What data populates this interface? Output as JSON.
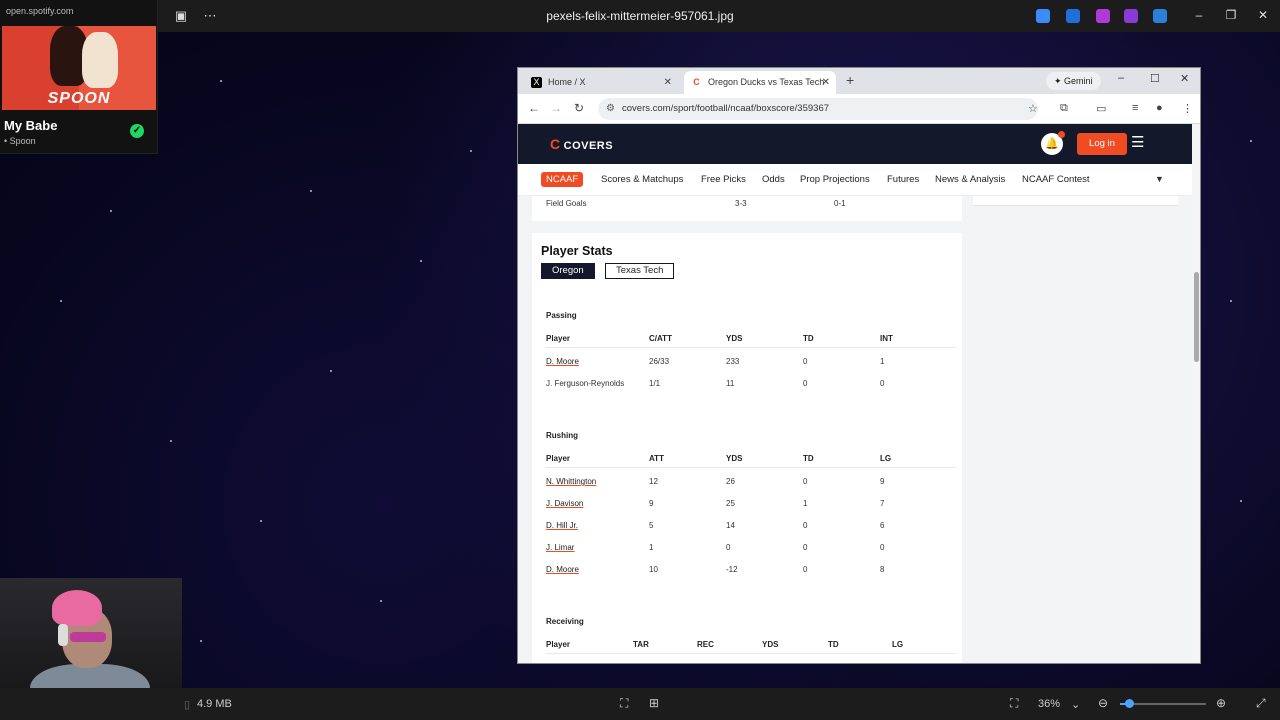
{
  "viewer": {
    "title": "pexels-felix-mittermeier-957061.jpg",
    "file_size": "4.9 MB",
    "zoom": "36%"
  },
  "spotify": {
    "url": "open.spotify.com",
    "album_text": "SPOON",
    "song": "My Babe",
    "artist": "• Spoon"
  },
  "browser": {
    "tabs": [
      {
        "label": "Home / X",
        "fav": "X"
      },
      {
        "label": "Oregon Ducks vs Texas Tech Re",
        "fav": "C"
      }
    ],
    "gemini_label": "Gemini",
    "url": "covers.com/sport/football/ncaaf/boxscore/359367"
  },
  "site": {
    "logo": "COVERS",
    "login": "Log in",
    "nav": [
      "NCAAF",
      "Scores & Matchups",
      "Free Picks",
      "Odds",
      "Prop Projections",
      "Futures",
      "News & Analysis",
      "NCAAF Contest"
    ]
  },
  "prev_row": {
    "label": "Field Goals",
    "v1": "3-3",
    "v2": "0-1"
  },
  "player_stats": {
    "title": "Player Stats",
    "teams": [
      "Oregon",
      "Texas Tech"
    ],
    "passing": {
      "title": "Passing",
      "headers": [
        "Player",
        "C/ATT",
        "YDS",
        "TD",
        "INT"
      ],
      "rows": [
        [
          "D. Moore",
          "26/33",
          "233",
          "0",
          "1"
        ],
        [
          "J. Ferguson-Reynolds",
          "1/1",
          "11",
          "0",
          "0"
        ]
      ]
    },
    "rushing": {
      "title": "Rushing",
      "headers": [
        "Player",
        "ATT",
        "YDS",
        "TD",
        "LG"
      ],
      "rows": [
        [
          "N. Whittington",
          "12",
          "26",
          "0",
          "9"
        ],
        [
          "J. Davison",
          "9",
          "25",
          "1",
          "7"
        ],
        [
          "D. Hill Jr.",
          "5",
          "14",
          "0",
          "6"
        ],
        [
          "J. Limar",
          "1",
          "0",
          "0",
          "0"
        ],
        [
          "D. Moore",
          "10",
          "-12",
          "0",
          "8"
        ]
      ]
    },
    "receiving": {
      "title": "Receiving",
      "headers": [
        "Player",
        "TAR",
        "REC",
        "YDS",
        "TD",
        "LG"
      ]
    }
  }
}
